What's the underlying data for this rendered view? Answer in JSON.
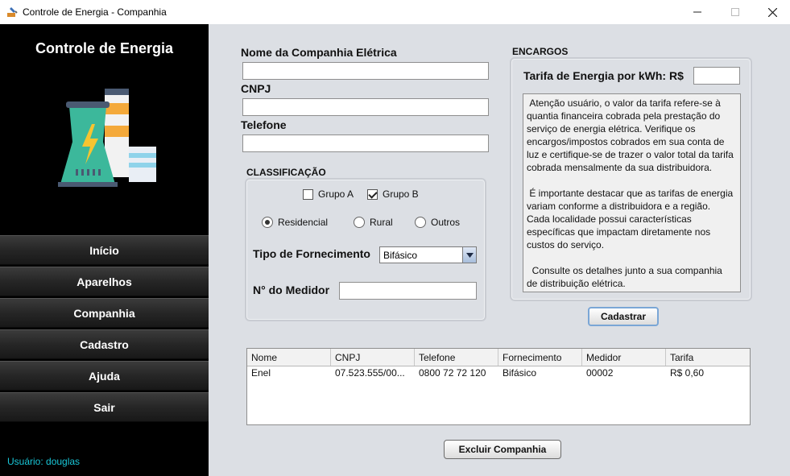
{
  "window": {
    "title": "Controle de Energia - Companhia"
  },
  "sidebar": {
    "title": "Controle de Energia",
    "menu": [
      "Início",
      "Aparelhos",
      "Companhia",
      "Cadastro",
      "Ajuda",
      "Sair"
    ],
    "user": "Usuário: douglas"
  },
  "form": {
    "company_name_label": "Nome da Companhia Elétrica",
    "company_name_value": "",
    "cnpj_label": "CNPJ",
    "cnpj_value": "",
    "phone_label": "Telefone",
    "phone_value": ""
  },
  "classification": {
    "title": "CLASSIFICAÇÃO",
    "group_a": {
      "label": "Grupo A",
      "checked": false
    },
    "group_b": {
      "label": "Grupo B",
      "checked": true
    },
    "radios": [
      {
        "label": "Residencial",
        "selected": true
      },
      {
        "label": "Rural",
        "selected": false
      },
      {
        "label": "Outros",
        "selected": false
      }
    ],
    "supply_label": "Tipo de Fornecimento",
    "supply_value": "Bifásico",
    "meter_label": "N° do Medidor",
    "meter_value": ""
  },
  "charges": {
    "title": "ENCARGOS",
    "tariff_label": "Tarifa de Energia por kWh: R$",
    "tariff_value": "",
    "notice": " Atenção usuário, o valor da tarifa refere-se à\nquantia financeira cobrada pela prestação do\nserviço de energia elétrica. Verifique os\nencargos/impostos cobrados em sua conta de\nluz e certifique-se de trazer o valor total da tarifa\ncobrada mensalmente da sua distribuidora.\n\n É importante destacar que as tarifas de energia\nvariam conforme a distribuidora e a região.\nCada localidade possui características\nespecíficas que impactam diretamente nos\ncustos do serviço.\n\n  Consulte os detalhes junto a sua companhia\nde distribuição elétrica.",
    "register_button": "Cadastrar"
  },
  "table": {
    "columns": [
      "Nome",
      "CNPJ",
      "Telefone",
      "Fornecimento",
      "Medidor",
      "Tarifa"
    ],
    "rows": [
      [
        "Enel",
        "07.523.555/00...",
        "0800 72 72 120",
        "Bifásico",
        "00002",
        "R$ 0,60"
      ]
    ]
  },
  "delete_button": "Excluir Companhia",
  "colors": {
    "sidebar_bg": "#000000",
    "main_bg": "#dcdfe4",
    "user_text": "#19c7d8"
  },
  "icons": [
    "power-plant-logo",
    "app-icon",
    "minimize-icon",
    "maximize-icon",
    "close-icon",
    "dropdown-arrow-icon"
  ]
}
